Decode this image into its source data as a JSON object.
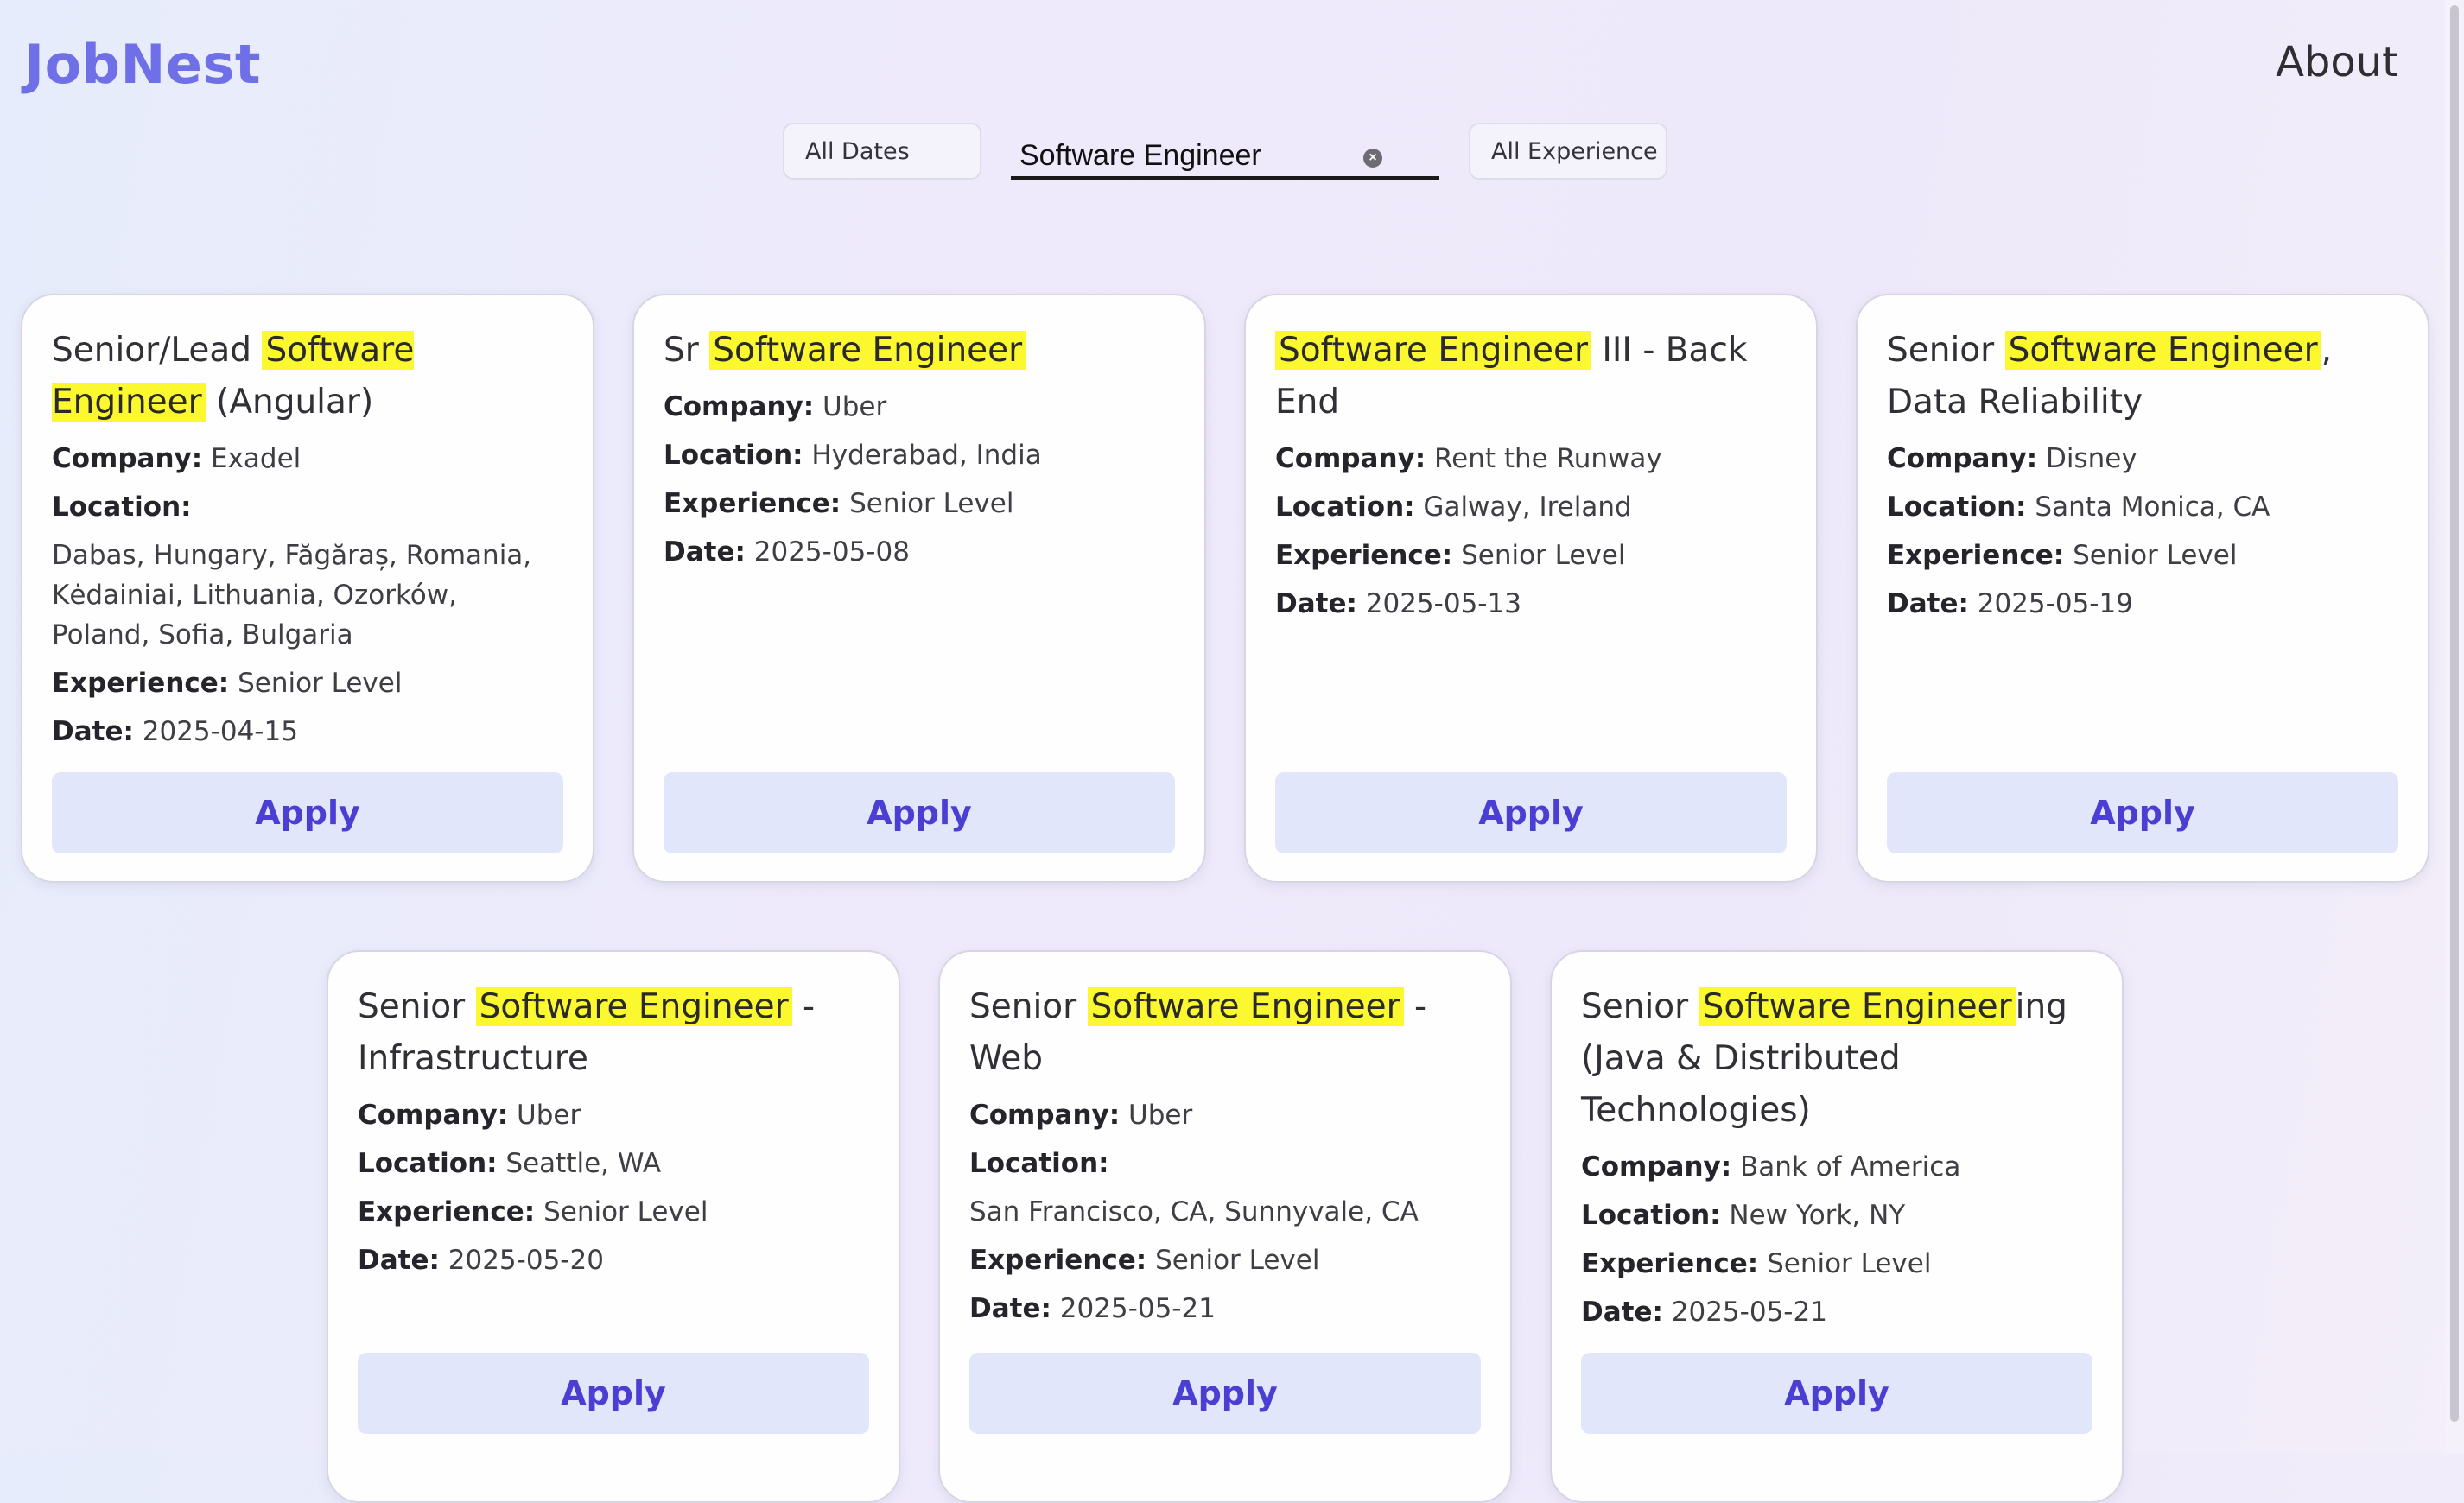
{
  "header": {
    "brand": "JobNest",
    "about": "About"
  },
  "filters": {
    "dates": "All Dates",
    "search_value": "Software Engineer",
    "experience": "All Experience"
  },
  "labels": {
    "company": "Company:",
    "location": "Location:",
    "experience": "Experience:",
    "date": "Date:",
    "apply": "Apply"
  },
  "jobs": [
    {
      "title_pre": "Senior/Lead ",
      "title_hl": "Software Engineer",
      "title_post": " (Angular)",
      "company": "Exadel",
      "location": "Dabas, Hungary, Făgăraș, Romania, Kėdainiai, Lithuania, Ozorków, Poland, Sofia, Bulgaria",
      "experience": "Senior Level",
      "date": "2025-04-15"
    },
    {
      "title_pre": "Sr ",
      "title_hl": "Software Engineer",
      "title_post": "",
      "company": "Uber",
      "location": "Hyderabad, India",
      "experience": "Senior Level",
      "date": "2025-05-08"
    },
    {
      "title_pre": "",
      "title_hl": "Software Engineer",
      "title_post": " III - Back End",
      "company": "Rent the Runway",
      "location": "Galway, Ireland",
      "experience": "Senior Level",
      "date": "2025-05-13"
    },
    {
      "title_pre": "Senior ",
      "title_hl": "Software Engineer",
      "title_post": ", Data Reliability",
      "company": "Disney",
      "location": "Santa Monica, CA",
      "experience": "Senior Level",
      "date": "2025-05-19"
    },
    {
      "title_pre": "Senior ",
      "title_hl": "Software Engineer",
      "title_post": " - Infrastructure",
      "company": "Uber",
      "location": "Seattle, WA",
      "experience": "Senior Level",
      "date": "2025-05-20"
    },
    {
      "title_pre": "Senior ",
      "title_hl": "Software Engineer",
      "title_post": " - Web",
      "company": "Uber",
      "location": "San Francisco, CA, Sunnyvale, CA",
      "experience": "Senior Level",
      "date": "2025-05-21"
    },
    {
      "title_pre": "Senior ",
      "title_hl": "Software Engineer",
      "title_post": "ing (Java & Distributed Technologies)",
      "company": "Bank of America",
      "location": "New York, NY",
      "experience": "Senior Level",
      "date": "2025-05-21"
    }
  ],
  "colors": {
    "brand": "#6f70e8",
    "highlight": "#fcf82f",
    "apply_bg": "#e2e6fb",
    "apply_text": "#4a3fd2"
  }
}
